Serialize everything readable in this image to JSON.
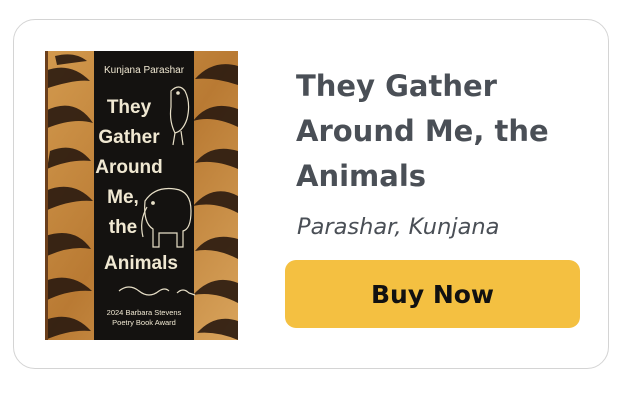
{
  "book": {
    "title": "They Gather Around Me, the Animals",
    "author": "Parashar, Kunjana",
    "buy_label": "Buy Now"
  },
  "cover": {
    "author_name": "Kunjana Parashar",
    "title_lines": [
      "They",
      "Gather",
      "Around",
      "Me,",
      "the",
      "Animals"
    ],
    "award_lines": [
      "2024 Barbara Stevens",
      "Poetry Book Award"
    ]
  },
  "colors": {
    "title_text": "#4a4f56",
    "button_bg": "#f4c041",
    "card_border": "#d4d4d4"
  }
}
